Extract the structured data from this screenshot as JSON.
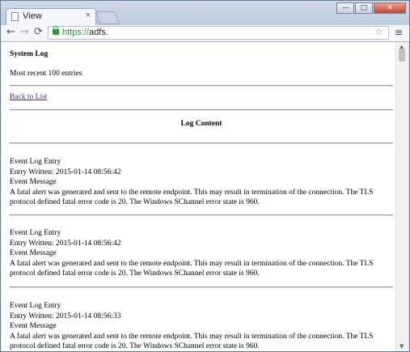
{
  "browser": {
    "tab_title": "View",
    "tab_close": "×",
    "url_scheme": "https://",
    "url_host": "adfs.",
    "back": "←",
    "forward": "→",
    "reload": "⟳",
    "star": "☆",
    "menu": "≡",
    "win_min": "—",
    "win_max": "□",
    "win_close": "✕"
  },
  "page": {
    "title": "System Log",
    "subtitle": "Most recent 100 entries",
    "back_link": "Back to List",
    "log_heading": "Log Content"
  },
  "entries": [
    {
      "type": "Event Log Entry",
      "written": "Entry Written: 2015-01-14 08:56:42",
      "label": "Event Message",
      "message": "A fatal alert was generated and sent to the remote endpoint. This may result in termination of the connection. The TLS protocol defined fatal error code is 20. The Windows SChannel error state is 960."
    },
    {
      "type": "Event Log Entry",
      "written": "Entry Written: 2015-01-14 08:56:42",
      "label": "Event Message",
      "message": "A fatal alert was generated and sent to the remote endpoint. This may result in termination of the connection. The TLS protocol defined fatal error code is 20. The Windows SChannel error state is 960."
    },
    {
      "type": "Event Log Entry",
      "written": "Entry Written: 2015-01-14 08:56:33",
      "label": "Event Message",
      "message": "A fatal alert was generated and sent to the remote endpoint. This may result in termination of the connection. The TLS protocol defined fatal error code is 20. The Windows SChannel error state is 960."
    }
  ]
}
